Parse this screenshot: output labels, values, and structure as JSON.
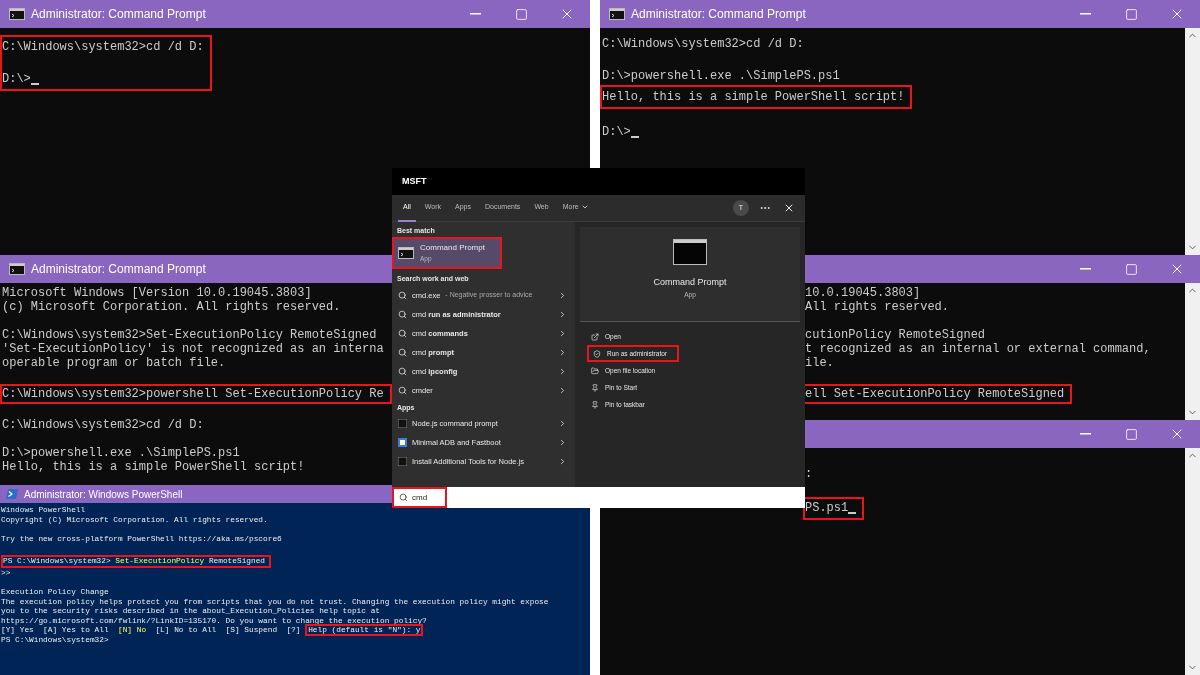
{
  "cmd_windows": [
    {
      "title": "Administrator: Command Prompt",
      "controls_visible": true,
      "blocks": [
        {
          "highlighted": true,
          "lines": [
            {
              "kind": "text",
              "text": "C:\\Windows\\system32>cd /d D:",
              "cursor": false
            },
            {
              "kind": "blank"
            },
            {
              "kind": "text",
              "text": "D:\\>",
              "cursor": true
            }
          ]
        }
      ]
    },
    {
      "title": "Administrator: Command Prompt",
      "controls_visible": true,
      "blocks": [
        {
          "highlighted": false,
          "lines": [
            {
              "kind": "text",
              "text": "C:\\Windows\\system32>cd /d D:",
              "cursor": false
            },
            {
              "kind": "blank"
            },
            {
              "kind": "text",
              "text": "D:\\>powershell.exe .\\SimplePS.ps1",
              "cursor": false
            }
          ]
        },
        {
          "highlighted": true,
          "lines": [
            {
              "kind": "text",
              "text": "Hello, this is a simple PowerShell script!",
              "cursor": false
            }
          ]
        },
        {
          "highlighted": false,
          "lines": [
            {
              "kind": "blank"
            },
            {
              "kind": "text",
              "text": "D:\\>",
              "cursor": true
            }
          ]
        }
      ]
    },
    {
      "title": "Administrator: Command Prompt",
      "controls_visible": false,
      "blocks": [
        {
          "highlighted": false,
          "lines": [
            {
              "kind": "text",
              "text": "Microsoft Windows [Version 10.0.19045.3803]",
              "cursor": false
            },
            {
              "kind": "text",
              "text": "(c) Microsoft Corporation. All rights reserved.",
              "cursor": false
            },
            {
              "kind": "blank"
            },
            {
              "kind": "text",
              "text": "C:\\Windows\\system32>Set-ExecutionPolicy RemoteSigned",
              "cursor": false
            },
            {
              "kind": "text",
              "text": "'Set-ExecutionPolicy' is not recognized as an interna",
              "cursor": false
            },
            {
              "kind": "text",
              "text": "operable program or batch file.",
              "cursor": false
            },
            {
              "kind": "blank"
            }
          ]
        },
        {
          "highlighted": true,
          "lines": [
            {
              "kind": "text",
              "text": "C:\\Windows\\system32>powershell Set-ExecutionPolicy Re",
              "cursor": false
            }
          ]
        },
        {
          "highlighted": false,
          "lines": [
            {
              "kind": "blank"
            },
            {
              "kind": "text",
              "text": "C:\\Windows\\system32>cd /d D:",
              "cursor": false
            },
            {
              "kind": "blank"
            },
            {
              "kind": "text",
              "text": "D:\\>powershell.exe .\\SimplePS.ps1",
              "cursor": false
            },
            {
              "kind": "text",
              "text": "Hello, this is a simple PowerShell script!",
              "cursor": false
            }
          ]
        }
      ]
    },
    {
      "controls_visible": true,
      "blocks": [
        {
          "highlighted": false,
          "lines": [
            {
              "kind": "text",
              "text": "10.0.19045.3803]",
              "cursor": false
            },
            {
              "kind": "text",
              "text": "All rights reserved.",
              "cursor": false
            },
            {
              "kind": "blank"
            },
            {
              "kind": "text",
              "text": "cutionPolicy RemoteSigned",
              "cursor": false
            },
            {
              "kind": "text",
              "text": "t recognized as an internal or external command,",
              "cursor": false
            },
            {
              "kind": "text",
              "text": "ile.",
              "cursor": false
            },
            {
              "kind": "blank"
            }
          ]
        },
        {
          "highlighted": true,
          "lines": [
            {
              "kind": "text",
              "text": "ell Set-ExecutionPolicy RemoteSigned",
              "cursor": false
            }
          ]
        }
      ]
    },
    {
      "controls_visible": true,
      "blocks": [
        {
          "highlighted": false,
          "lines": [
            {
              "kind": "text",
              "text": ":",
              "cursor": false
            },
            {
              "kind": "blank"
            }
          ]
        },
        {
          "highlighted": true,
          "lines": [
            {
              "kind": "text",
              "text": "PS.ps1",
              "cursor": true
            }
          ]
        }
      ]
    }
  ],
  "powershell": {
    "title": "Administrator: Windows PowerShell",
    "lines": [
      {
        "kind": "text",
        "highlighted": false,
        "parts": [
          {
            "text": "Windows PowerShell",
            "accent": false,
            "highlighted": false
          }
        ]
      },
      {
        "kind": "text",
        "highlighted": false,
        "parts": [
          {
            "text": "Copyright (C) Microsoft Corporation. All rights reserved.",
            "accent": false,
            "highlighted": false
          }
        ]
      },
      {
        "kind": "blank"
      },
      {
        "kind": "text",
        "highlighted": false,
        "parts": [
          {
            "text": "Try the new cross-platform PowerShell https://aka.ms/pscore6",
            "accent": false,
            "highlighted": false
          }
        ]
      },
      {
        "kind": "blank"
      },
      {
        "kind": "text",
        "highlighted": true,
        "parts": [
          {
            "text": "PS C:\\Windows\\system32> ",
            "accent": false,
            "highlighted": false
          },
          {
            "text": "Set-ExecutionPolicy",
            "accent": true,
            "highlighted": false
          },
          {
            "text": " RemoteSigned",
            "accent": false,
            "highlighted": false
          }
        ]
      },
      {
        "kind": "text",
        "highlighted": false,
        "parts": [
          {
            "text": ">>",
            "accent": false,
            "highlighted": false
          }
        ]
      },
      {
        "kind": "blank"
      },
      {
        "kind": "text",
        "highlighted": false,
        "parts": [
          {
            "text": "Execution Policy Change",
            "accent": false,
            "highlighted": false
          }
        ]
      },
      {
        "kind": "text",
        "highlighted": false,
        "parts": [
          {
            "text": "The execution policy helps protect you from scripts that you do not trust. Changing the execution policy might expose",
            "accent": false,
            "highlighted": false
          }
        ]
      },
      {
        "kind": "text",
        "highlighted": false,
        "parts": [
          {
            "text": "you to the security risks described in the about_Execution_Policies help topic at",
            "accent": false,
            "highlighted": false
          }
        ]
      },
      {
        "kind": "text",
        "highlighted": false,
        "parts": [
          {
            "text": "https://go.microsoft.com/fwlink/?LinkID=135170. Do you want to change the execution policy?",
            "accent": false,
            "highlighted": false
          }
        ]
      },
      {
        "kind": "text",
        "highlighted": false,
        "parts": [
          {
            "text": "[Y] Yes  [A] Yes to All  ",
            "accent": false,
            "highlighted": false
          },
          {
            "text": "[N] No",
            "accent": true,
            "highlighted": false
          },
          {
            "text": "  [L] No to All  [S] Suspend  [?] ",
            "accent": false,
            "highlighted": false
          },
          {
            "text": "Help (default is \"N\"): y",
            "accent": false,
            "highlighted": true
          }
        ]
      },
      {
        "kind": "text",
        "highlighted": false,
        "parts": [
          {
            "text": "PS C:\\Windows\\system32>",
            "accent": false,
            "highlighted": false
          }
        ]
      }
    ]
  },
  "search_panel": {
    "header": "MSFT",
    "tabs": [
      {
        "label": "All",
        "selected": true,
        "has_menu": false
      },
      {
        "label": "Work",
        "selected": false,
        "has_menu": false
      },
      {
        "label": "Apps",
        "selected": false,
        "has_menu": false
      },
      {
        "label": "Documents",
        "selected": false,
        "has_menu": false
      },
      {
        "label": "Web",
        "selected": false,
        "has_menu": false
      },
      {
        "label": "More",
        "selected": false,
        "has_menu": true
      }
    ],
    "avatar": "T",
    "best_match_heading": "Best match",
    "best_match": {
      "title": "Command Prompt",
      "subtitle": "App",
      "selected": true,
      "highlighted": true
    },
    "web_heading": "Search work and web",
    "web_results": [
      {
        "text": "cmd.exe",
        "detail": "- Negative prosser to advice"
      },
      {
        "text": "cmd **run as administrator**"
      },
      {
        "text": "cmd **commands**"
      },
      {
        "text": "cmd **prompt**"
      },
      {
        "text": "cmd **ipconfig**"
      },
      {
        "text": "cmder"
      }
    ],
    "apps_heading": "Apps",
    "apps": [
      {
        "name": "Node.js command prompt",
        "kind": "terminal"
      },
      {
        "name": "Minimal ADB and Fastboot",
        "kind": "tool"
      },
      {
        "name": "Install Additional Tools for Node.js",
        "kind": "terminal"
      }
    ],
    "preview": {
      "title": "Command Prompt",
      "subtitle": "App"
    },
    "actions": [
      {
        "label": "Open",
        "highlighted": false
      },
      {
        "label": "Run as administrator",
        "highlighted": true
      },
      {
        "label": "Open file location",
        "highlighted": false
      },
      {
        "label": "Pin to Start",
        "highlighted": false
      },
      {
        "label": "Pin to taskbar",
        "highlighted": false
      }
    ],
    "search_box": {
      "value": "cmd",
      "highlighted": true
    }
  }
}
